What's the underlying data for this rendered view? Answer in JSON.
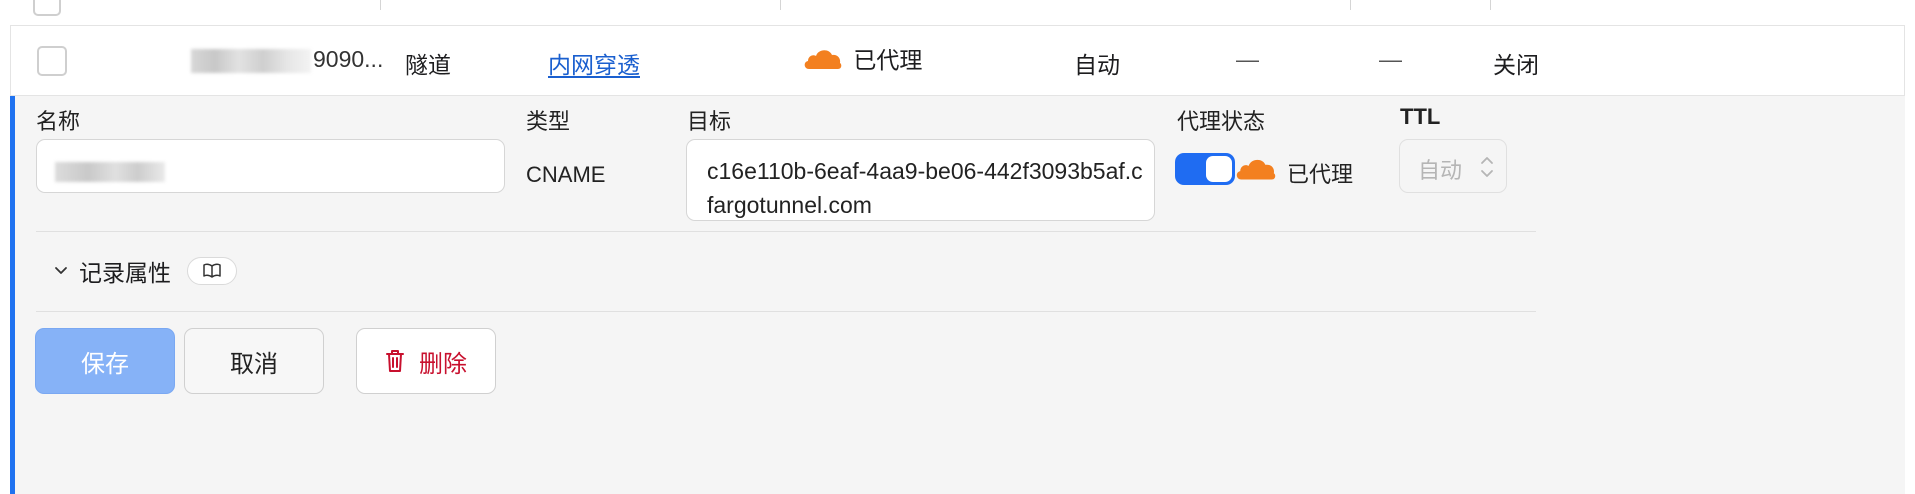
{
  "table": {
    "row": {
      "name_suffix": "9090...",
      "type": "隧道",
      "content": "内网穿透",
      "proxy_status": "已代理",
      "ttl": "自动",
      "col6": "—",
      "col7": "—",
      "col8": "关闭"
    }
  },
  "editor": {
    "name_label": "名称",
    "type_label": "类型",
    "type_value": "CNAME",
    "target_label": "目标",
    "target_value": "c16e110b-6eaf-4aa9-be06-442f3093b5af.cfargotunnel.com",
    "proxy_label": "代理状态",
    "proxy_enabled": true,
    "proxy_text": "已代理",
    "ttl_label": "TTL",
    "ttl_value": "自动",
    "record_props_label": "记录属性",
    "save_label": "保存",
    "cancel_label": "取消",
    "delete_label": "删除"
  },
  "colors": {
    "accent": "#1f72f0",
    "cloud": "#f38020",
    "danger": "#c8102e",
    "link": "#1a5fcf"
  },
  "icons": {
    "proxy": "cloud-icon",
    "expand": "chevron-down-icon",
    "docs": "book-icon",
    "delete": "trash-icon",
    "ttl": "updown-chevron-icon"
  }
}
